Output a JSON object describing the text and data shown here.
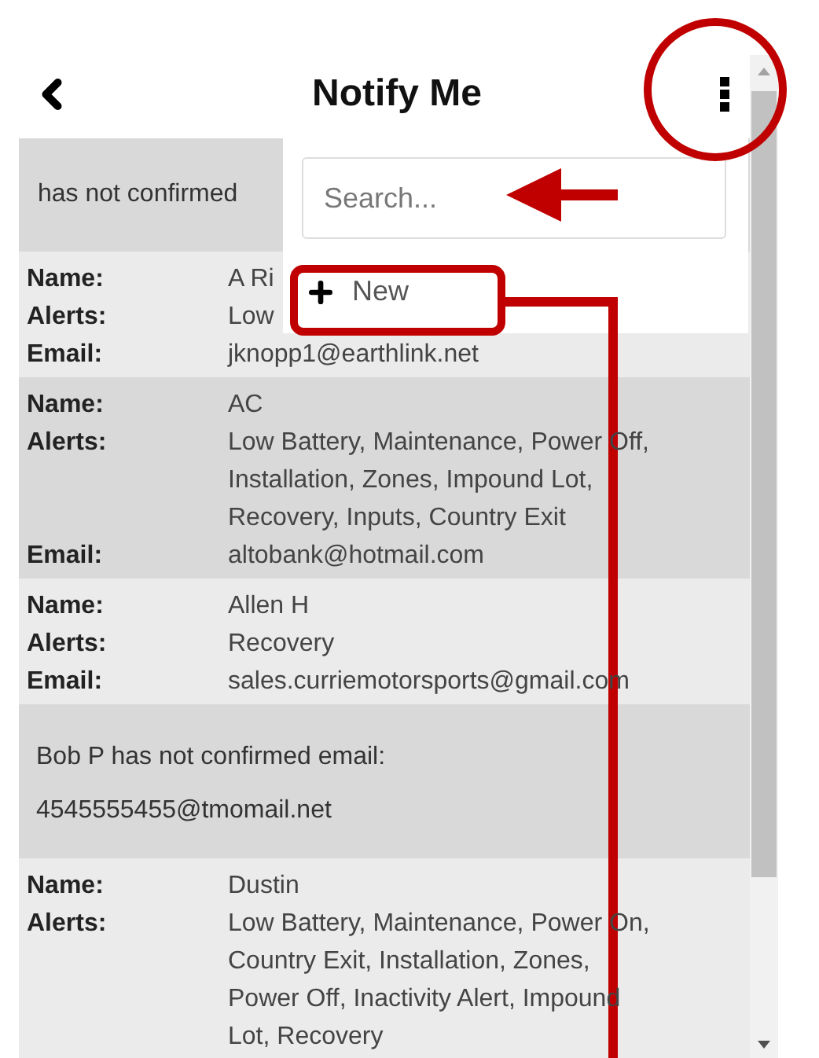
{
  "header": {
    "title": "Notify Me"
  },
  "menu": {
    "search_placeholder": "Search...",
    "new_label": "New"
  },
  "rows": [
    {
      "kind": "unconfirmed",
      "lines": [
        "has not confirmed"
      ]
    },
    {
      "kind": "contact",
      "fields": [
        {
          "label": "Name:",
          "value": "A Ri"
        },
        {
          "label": "Alerts:",
          "value": "Low"
        },
        {
          "label": "Email:",
          "value": "jknopp1@earthlink.net"
        }
      ]
    },
    {
      "kind": "contact",
      "fields": [
        {
          "label": "Name:",
          "value": "AC"
        },
        {
          "label": "Alerts:",
          "value": "Low Battery, Maintenance, Power Off, Installation, Zones, Impound Lot, Recovery, Inputs, Country Exit"
        },
        {
          "label": "Email:",
          "value": "altobank@hotmail.com"
        }
      ]
    },
    {
      "kind": "contact",
      "fields": [
        {
          "label": "Name:",
          "value": "Allen H"
        },
        {
          "label": "Alerts:",
          "value": "Recovery"
        },
        {
          "label": "Email:",
          "value": "sales.curriemotorsports@gmail.com"
        }
      ]
    },
    {
      "kind": "unconfirmed",
      "lines": [
        "Bob P has not confirmed email:",
        "4545555455@tmomail.net"
      ]
    },
    {
      "kind": "contact",
      "fields": [
        {
          "label": "Name:",
          "value": "Dustin"
        },
        {
          "label": "Alerts:",
          "value": "Low Battery, Maintenance, Power On, Country Exit, Installation, Zones, Power Off, Inactivity Alert, Impound Lot, Recovery"
        }
      ]
    }
  ]
}
